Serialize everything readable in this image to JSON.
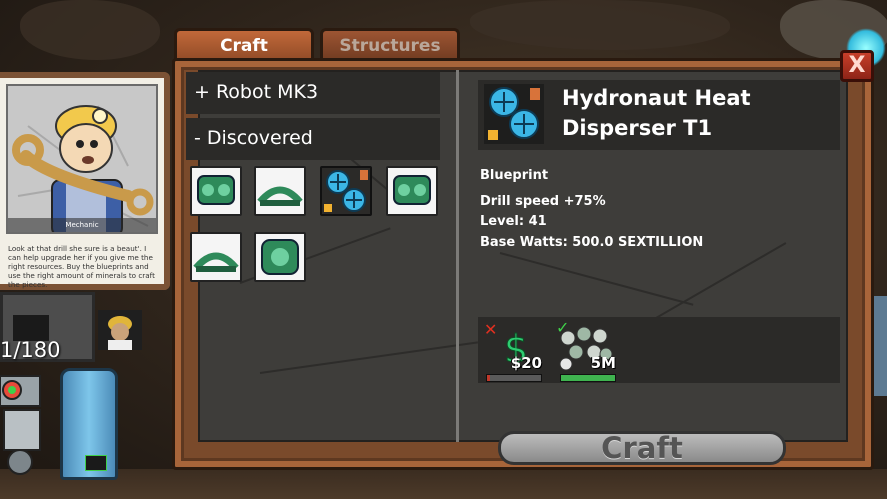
{
  "tabs": [
    {
      "label": "Craft",
      "active": true
    },
    {
      "label": "Structures",
      "active": false
    }
  ],
  "close_label": "X",
  "portrait": {
    "caption": "Mechanic",
    "text": "Look at that drill she sure is a beaut'. I can help upgrade her if you give me the right resources. Buy the blueprints and use the right amount of minerals to craft the pieces."
  },
  "hud": {
    "counter": "1/180"
  },
  "list": {
    "category_robot": "+ Robot MK3",
    "category_discovered": "- Discovered",
    "slot_icons": [
      "green-module-icon",
      "green-pipe-icon",
      "blue-fan-icon",
      "green-module-icon",
      "green-pipe-icon",
      "green-module-icon"
    ],
    "selected_slot": 2
  },
  "detail": {
    "title": "Hydronaut Heat Disperser T1",
    "section": "Blueprint",
    "stats": [
      "Drill speed +75%",
      "Level: 41",
      "Base Watts: 500.0 SEXTILLION"
    ]
  },
  "costs": [
    {
      "icon": "dollar-icon",
      "label": "$20",
      "met": false,
      "progress": 0.05,
      "color": "#c0392b"
    },
    {
      "icon": "minerals-icon",
      "label": "5M",
      "met": true,
      "progress": 1.0,
      "color": "#3fb34f"
    }
  ],
  "craft_label": "Craft",
  "colors": {
    "panel_wood": "#7a4a2b",
    "panel_bg": "#3e3d3a",
    "row_bg": "#2b2a28",
    "close_red": "#c63f2a"
  }
}
